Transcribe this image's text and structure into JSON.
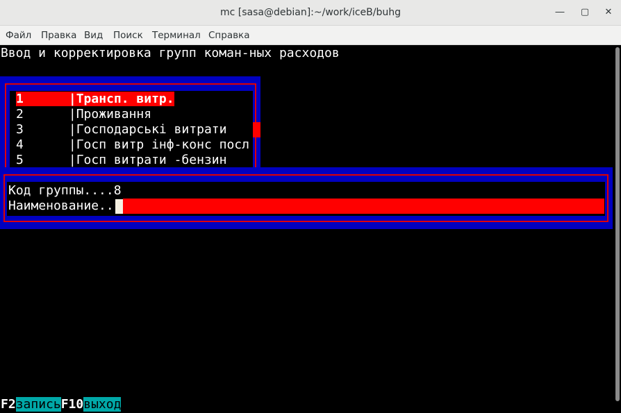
{
  "window": {
    "title": "mc [sasa@debian]:~/work/iceB/buhg",
    "minimize_icon": "minimize-icon",
    "maximize_icon": "maximize-icon",
    "close_icon": "close-icon"
  },
  "menu": {
    "items": [
      "Файл",
      "Правка",
      "Вид",
      "Поиск",
      "Терминал",
      "Справка"
    ]
  },
  "screen": {
    "heading": "Ввод и корректировка групп коман-ных расходов"
  },
  "list": {
    "rows": [
      {
        "num": "1",
        "sep": "|",
        "name": "Трансп. витр."
      },
      {
        "num": "2",
        "sep": "|",
        "name": "Проживання"
      },
      {
        "num": "3",
        "sep": "|",
        "name": "Господарські витрати"
      },
      {
        "num": "4",
        "sep": "|",
        "name": "Госп витр інф-конс посл"
      },
      {
        "num": "5",
        "sep": "|",
        "name": "Госп витрати -бензин"
      }
    ],
    "selected_index": 0
  },
  "form": {
    "code_label": "Код группы....",
    "code_value": "8",
    "name_label": "Наименование..",
    "name_value": ""
  },
  "fkeys": [
    {
      "key": "F2",
      "label": "запись"
    },
    {
      "key": "F10",
      "label": "выход"
    }
  ],
  "colors": {
    "panel_blue": "#0000c0",
    "frame_red": "#e00000",
    "highlight_red": "#ff0000",
    "fkey_cyan": "#00a8a8"
  }
}
